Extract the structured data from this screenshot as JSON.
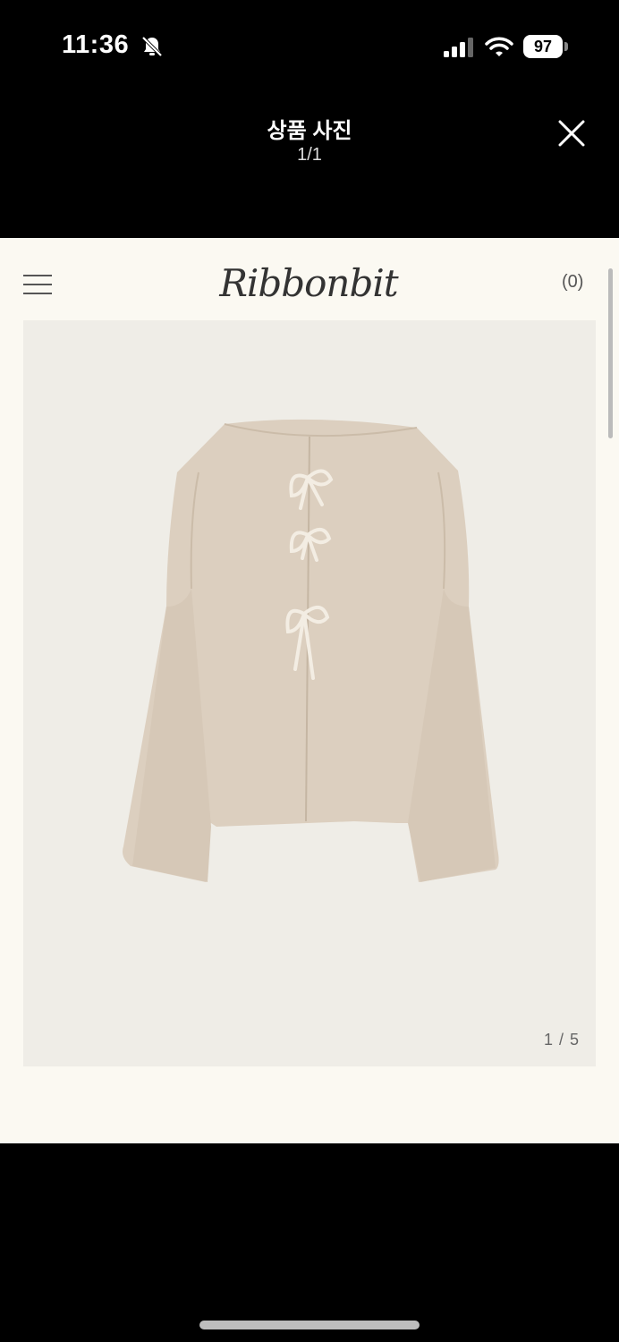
{
  "status_bar": {
    "time": "11:36",
    "battery": "97",
    "icons": [
      "bell-slash-icon",
      "signal-icon",
      "wifi-icon",
      "battery-icon"
    ]
  },
  "viewer": {
    "title": "상품 사진",
    "counter": "1/1",
    "close_icon": "close-icon"
  },
  "page": {
    "brand": "Ribbonbit",
    "cart_count": "(0)",
    "menu_icon": "hamburger-menu-icon",
    "image_counter": "1 / 5",
    "colors": {
      "page_bg": "#fbf9f2",
      "image_bg": "#efede7",
      "knit": "#dccfbf"
    }
  }
}
